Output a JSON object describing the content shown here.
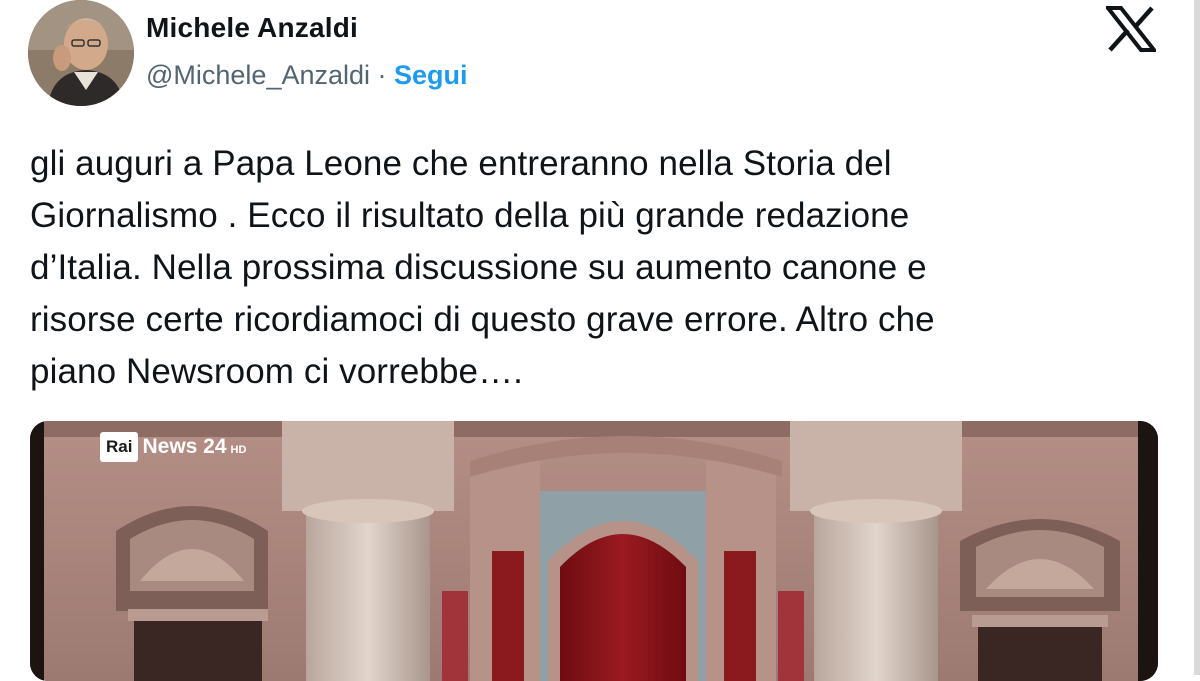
{
  "author": {
    "name": "Michele Anzaldi",
    "handle": "@Michele_Anzaldi",
    "separator": " · ",
    "follow_label": "Segui"
  },
  "icons": {
    "platform": "x-logo-icon",
    "avatar": "avatar-photo"
  },
  "tweet": {
    "text": "gli auguri a Papa Leone che entreranno nella Storia del\nGiornalismo . Ecco  il risultato della più grande redazione\nd’Italia. Nella  prossima discussione su aumento canone e\nrisorse certe ricordiamoci di questo grave  errore. Altro che\npiano Newsroom ci vorrebbe…."
  },
  "media": {
    "channel_logo_rai": "Rai",
    "channel_logo_name": "News 24",
    "channel_logo_suffix": "HD"
  },
  "colors": {
    "link_blue": "#1d9bf0",
    "secondary_text": "#536471",
    "primary_text": "#0f1419",
    "curtain_red": "#8a1218"
  }
}
